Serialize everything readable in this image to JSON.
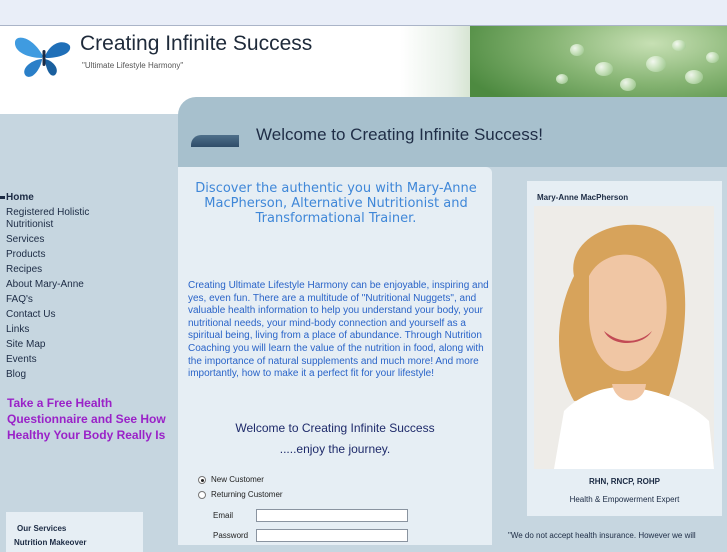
{
  "brand": {
    "title": "Creating Infinite Success",
    "tagline": "\"Ultimate Lifestyle Harmony\""
  },
  "banner": {
    "title": "Welcome to Creating Infinite Success!"
  },
  "nav": {
    "items": [
      {
        "label": "Home"
      },
      {
        "label": "Registered Holistic Nutritionist"
      },
      {
        "label": "Services"
      },
      {
        "label": "Products"
      },
      {
        "label": "Recipes"
      },
      {
        "label": "About Mary-Anne"
      },
      {
        "label": "FAQ's"
      },
      {
        "label": "Contact Us"
      },
      {
        "label": "Links"
      },
      {
        "label": "Site Map"
      },
      {
        "label": "Events"
      },
      {
        "label": "Blog"
      }
    ]
  },
  "promo": {
    "text": "Take a Free Health Questionnaire and See How Healthy Your Body Really Is"
  },
  "services": {
    "title": "Our Services",
    "first_item": "Nutrition Makeover"
  },
  "main": {
    "headline": "Discover the authentic you with Mary-Anne MacPherson, Alternative Nutritionist and Transformational Trainer.",
    "body": "Creating Ultimate Lifestyle Harmony can be enjoyable, inspiring and yes, even fun.  There are a multitude of \"Nutritional Nuggets\", and valuable health information to help you understand your body, your nutritional needs, your mind-body connection and yourself as a spiritual being, living from a place of abundance. Through Nutrition Coaching you will learn the value of the nutrition in food, along with the importance of natural supplements and much more! And more importantly, how to make it a perfect fit for your lifestyle!",
    "welcome": "Welcome to Creating Infinite Success",
    "journey": ".....enjoy the journey."
  },
  "login": {
    "new_customer": "New Customer",
    "returning_customer": "Returning Customer",
    "email_label": "Email",
    "password_label": "Password",
    "email_value": "",
    "password_value": ""
  },
  "profile": {
    "name": "Mary-Anne MacPherson",
    "credentials": "RHN, RNCP, ROHP",
    "role": "Health & Empowerment Expert",
    "quote": "\"We do not accept health insurance. However we will"
  },
  "colors": {
    "accent": "#3f87d8",
    "promo": "#9a22c8",
    "nav": "#1c2b44",
    "panel": "#e6eef4",
    "background": "#c6d6e0"
  }
}
